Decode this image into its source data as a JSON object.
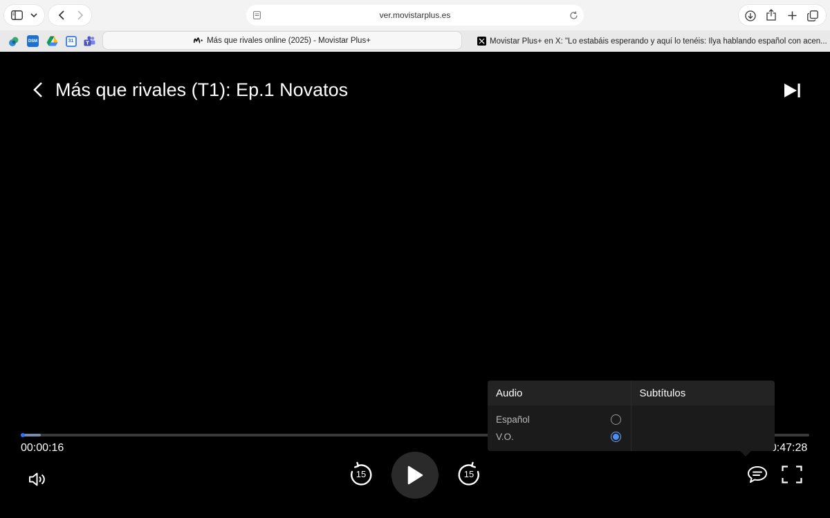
{
  "browser": {
    "url": "ver.movistarplus.es",
    "tabs": [
      {
        "label": "Más que rivales online (2025) - Movistar Plus+",
        "active": true
      },
      {
        "label": "Movistar Plus+ en X: \"Lo estabáis esperando y aquí lo tenéis: Ilya hablando español con acen...",
        "active": false
      }
    ],
    "favorites": [
      {
        "icon": "app-icon",
        "label": ""
      },
      {
        "icon": "dsm-icon",
        "label": "DSM"
      },
      {
        "icon": "drive-icon",
        "label": ""
      },
      {
        "icon": "calendar-icon",
        "label": "31"
      },
      {
        "icon": "teams-icon",
        "label": ""
      }
    ]
  },
  "player": {
    "title": "Más que rivales (T1): Ep.1 Novatos",
    "current_time": "00:00:16",
    "duration": "00:47:28",
    "progress_percent": 2.5,
    "skip_back_seconds": "15",
    "skip_forward_seconds": "15"
  },
  "popup": {
    "audio_header": "Audio",
    "subtitles_header": "Subtítulos",
    "audio_options": [
      {
        "label": "Español",
        "selected": false
      },
      {
        "label": "V.O.",
        "selected": true
      }
    ]
  },
  "colors": {
    "accent": "#4b8ef5",
    "background": "#000000",
    "popup_bg": "#1b1b1b"
  }
}
